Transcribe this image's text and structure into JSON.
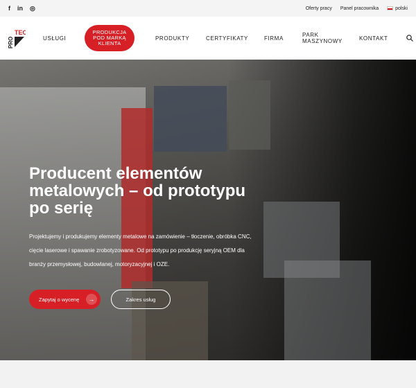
{
  "topbar": {
    "social": [
      {
        "icon": "facebook-icon",
        "glyph": "f"
      },
      {
        "icon": "linkedin-icon",
        "glyph": "in"
      },
      {
        "icon": "instagram-icon",
        "glyph": "◎"
      }
    ],
    "links": [
      "Oferty pracy",
      "Panel pracownika"
    ],
    "language": "polski"
  },
  "logo": {
    "text_top": "TEC",
    "text_side": "PRO"
  },
  "nav": {
    "items": [
      "USŁUGI",
      "PRODUKTY",
      "CERTYFIKATY",
      "FIRMA",
      "PARK MASZYNOWY",
      "KONTAKT"
    ],
    "highlight": "PRODUKCJA POD MARKĄ KLIENTA",
    "search_icon": "search-icon"
  },
  "hero": {
    "title": "Producent elementów metalowych – od prototypu po serię",
    "description": "Projektujemy i produkujemy elementy metalowe na zamówienie – tłoczenie, obróbka CNC, cięcie laserowe i spawanie zrobotyzowane. Od prototypu po produkcję seryjną OEM dla branży przemysłowej, budowlanej, motoryzacyjnej i OZE.",
    "primary_button": "Zapytaj o wycenę",
    "primary_arrow": "→",
    "secondary_button": "Zakres usług"
  },
  "colors": {
    "accent": "#d71f26",
    "text": "#222222"
  }
}
